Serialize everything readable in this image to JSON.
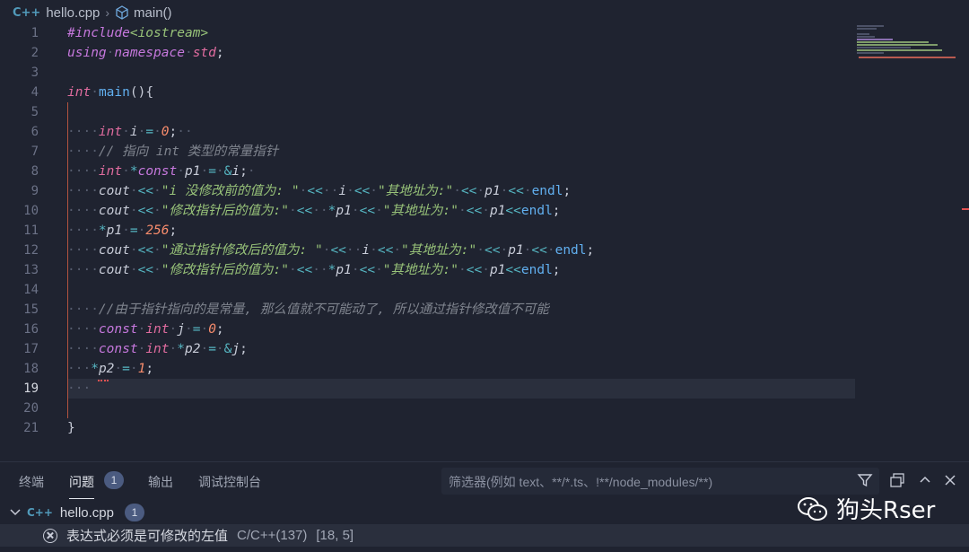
{
  "breadcrumb": {
    "lang_glyph": "C++",
    "file": "hello.cpp",
    "separator": "›",
    "symbol": "main()"
  },
  "editor": {
    "line_numbers": [
      "1",
      "2",
      "3",
      "4",
      "5",
      "6",
      "7",
      "8",
      "9",
      "10",
      "11",
      "12",
      "13",
      "14",
      "15",
      "16",
      "17",
      "18",
      "19",
      "20",
      "21"
    ],
    "current_line": "19",
    "l1": {
      "directive": "#include",
      "header": "<iostream>"
    },
    "l2": {
      "using": "using",
      "namespace": "namespace",
      "std": "std",
      "semi": ";"
    },
    "l4": {
      "type": "int",
      "name": "main",
      "rest": "(){"
    },
    "l6": {
      "type": "int",
      "var": "i",
      "eq": "=",
      "val": "0",
      "semi": ";"
    },
    "l7": {
      "comment": "// 指向 int 类型的常量指针"
    },
    "l8": {
      "type": "int",
      "star": "*",
      "const": "const",
      "var": "p1",
      "eq": "=",
      "amp": "&",
      "ref": "i",
      "semi": ";"
    },
    "l9": {
      "cout": "cout",
      "op": "<<",
      "s1": "\"i 没修改前的值为: \"",
      "v": "i",
      "s2": "\"其地址为:\"",
      "p": "p1",
      "endl": "endl",
      "semi": ";"
    },
    "l10": {
      "cout": "cout",
      "op": "<<",
      "s1": "\"修改指针后的值为:\"",
      "star": "*",
      "v": "p1",
      "s2": "\"其地址为:\"",
      "p": "p1",
      "endl": "endl",
      "semi": ";"
    },
    "l11": {
      "star": "*",
      "var": "p1",
      "eq": "=",
      "val": "256",
      "semi": ";"
    },
    "l12": {
      "cout": "cout",
      "op": "<<",
      "s1": "\"通过指针修改后的值为: \"",
      "v": "i",
      "s2": "\"其地址为:\"",
      "p": "p1",
      "endl": "endl",
      "semi": ";"
    },
    "l13": {
      "cout": "cout",
      "op": "<<",
      "s1": "\"修改指针后的值为:\"",
      "star": "*",
      "v": "p1",
      "s2": "\"其地址为:\"",
      "p": "p1",
      "endl": "endl",
      "semi": ";"
    },
    "l15": {
      "comment": "//由于指针指向的是常量, 那么值就不可能动了, 所以通过指针修改值不可能"
    },
    "l16": {
      "const": "const",
      "type": "int",
      "var": "j",
      "eq": "=",
      "val": "0",
      "semi": ";"
    },
    "l17": {
      "const": "const",
      "type": "int",
      "star": "*",
      "var": "p2",
      "eq": "=",
      "amp": "&",
      "ref": "j",
      "semi": ";"
    },
    "l18": {
      "star": "*",
      "var": "p2",
      "eq": "=",
      "val": "1",
      "semi": ";"
    },
    "l21": {
      "brace": "}"
    }
  },
  "panel": {
    "tabs": [
      "终端",
      "问题",
      "输出",
      "调试控制台"
    ],
    "problems_count": "1",
    "filter_placeholder": "筛选器(例如 text、**/*.ts、!**/node_modules/**)",
    "file_row": {
      "lang_glyph": "C++",
      "file": "hello.cpp",
      "count": "1"
    },
    "error": {
      "message": "表达式必须是可修改的左值",
      "source": "C/C++(137)",
      "position": "[18, 5]"
    }
  },
  "watermark": {
    "text": "狗头Rser"
  },
  "colors": {
    "background": "#1f2330",
    "keyword": "#c678dd",
    "string": "#98c379",
    "number": "#f78c6c",
    "error": "#e05252"
  }
}
